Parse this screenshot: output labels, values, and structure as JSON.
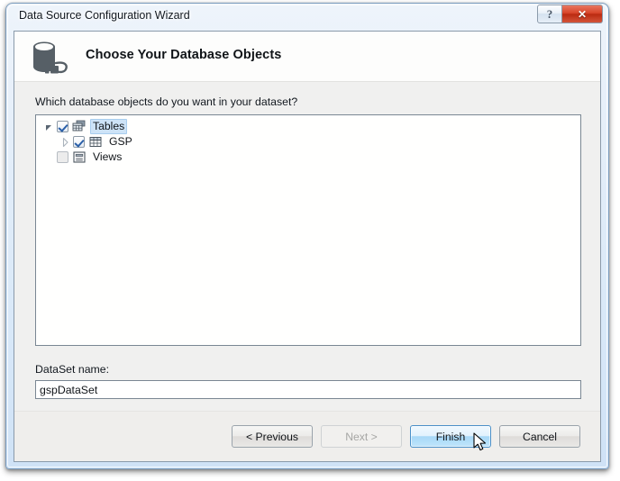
{
  "window": {
    "title": "Data Source Configuration Wizard",
    "help_button": "?",
    "close_button": "✕"
  },
  "header": {
    "icon": "database-connection-icon",
    "title": "Choose Your Database Objects"
  },
  "body": {
    "prompt": "Which database objects do you want in your dataset?",
    "tree": [
      {
        "label": "Tables",
        "level": 0,
        "expander": "expanded",
        "checked": true,
        "selected": true,
        "icon": "tables-stack-icon"
      },
      {
        "label": "GSP",
        "level": 1,
        "expander": "collapsed",
        "checked": true,
        "selected": false,
        "icon": "table-grid-icon"
      },
      {
        "label": "Views",
        "level": 0,
        "expander": "none",
        "checked": false,
        "selected": false,
        "icon": "view-window-icon"
      }
    ],
    "dataset_label": "DataSet name:",
    "dataset_value": "gspDataSet",
    "dataset_placeholder": ""
  },
  "buttons": {
    "previous": "< Previous",
    "next": "Next >",
    "finish": "Finish",
    "cancel": "Cancel"
  },
  "colors": {
    "accent": "#4b90c8",
    "selection": "#cde3f7",
    "close_button": "#bb2a10",
    "icon_dark": "#565f66"
  }
}
